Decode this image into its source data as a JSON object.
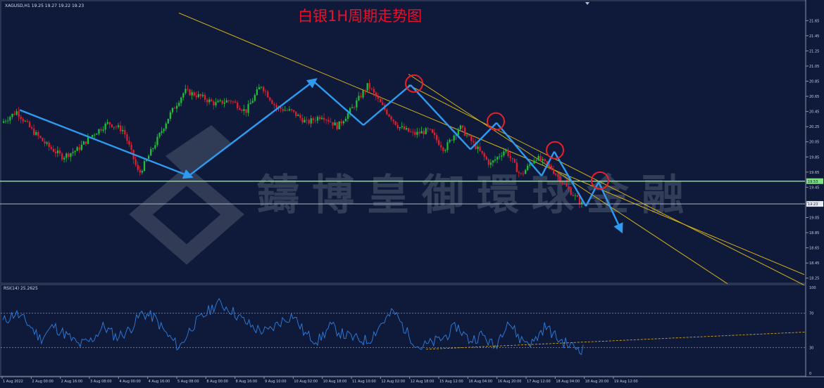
{
  "header": {
    "symbol_info": "XAGUSD,H1  19.25 19.27 19.22 19.23",
    "title": "白银1H周期走势图"
  },
  "watermark": {
    "text": "鑄博皇御環球金融"
  },
  "colors": {
    "background": "#0f1a3a",
    "up_candle": "#1fbf3a",
    "down_candle": "#e01e2e",
    "trend_arrow": "#2e9bf0",
    "channel_line": "#d4b21a",
    "circle": "#e8202a",
    "support_line": "#7ee07e",
    "current_line": "#c0c6d4",
    "rsi_line": "#2e7fe0",
    "rsi_trend": "#d4a21a",
    "title": "#e8102a"
  },
  "chart_data": [
    {
      "type": "candlestick",
      "title": "白银1H周期走势图",
      "price_ticks": [
        "21.65",
        "21.45",
        "21.25",
        "21.05",
        "20.85",
        "20.65",
        "20.45",
        "20.25",
        "20.05",
        "19.85",
        "19.65",
        "19.45",
        "19.25",
        "19.05",
        "18.85",
        "18.65",
        "18.45",
        "18.25"
      ],
      "ylim": [
        18.25,
        21.75
      ],
      "time_ticks": [
        "1 Aug 2022",
        "2 Aug 00:00",
        "2 Aug 16:00",
        "3 Aug 08:00",
        "4 Aug 00:00",
        "4 Aug 16:00",
        "5 Aug 08:00",
        "8 Aug 00:00",
        "8 Aug 16:00",
        "9 Aug 10:00",
        "10 Aug 02:00",
        "10 Aug 18:00",
        "11 Aug 10:00",
        "12 Aug 02:00",
        "12 Aug 18:00",
        "15 Aug 12:00",
        "16 Aug 04:00",
        "16 Aug 20:00",
        "17 Aug 12:00",
        "18 Aug 04:00",
        "18 Aug 20:00",
        "19 Aug 12:00"
      ],
      "key_levels": [
        {
          "name": "support",
          "value": 19.53,
          "label": "19.53"
        },
        {
          "name": "current",
          "value": 19.23,
          "label": "19.23"
        }
      ],
      "trend_path_prices": [
        20.47,
        19.6,
        20.85,
        20.27,
        20.8,
        19.95,
        20.3,
        19.6,
        19.92,
        19.2,
        19.52,
        18.9
      ],
      "pivot_circles": [
        20.8,
        20.3,
        19.92,
        19.52
      ],
      "channel": {
        "upper_start": 21.75,
        "upper_end": 18.25,
        "lower_start": 20.85,
        "lower_end": 18.25
      },
      "price_anchors": [
        20.3,
        20.45,
        20.2,
        20.0,
        19.85,
        19.95,
        20.15,
        20.3,
        20.2,
        19.62,
        20.0,
        20.4,
        20.72,
        20.65,
        20.55,
        20.6,
        20.45,
        20.8,
        20.5,
        20.45,
        20.3,
        20.4,
        20.25,
        20.5,
        20.8,
        20.5,
        20.25,
        20.15,
        20.2,
        19.95,
        20.25,
        20.0,
        19.75,
        19.95,
        19.6,
        19.85,
        19.7,
        19.45,
        19.23
      ]
    },
    {
      "type": "line",
      "title": "RSI(14) 25.2625",
      "series_name": "RSI(14)",
      "ylim": [
        0,
        100
      ],
      "rsi_ticks": [
        "100",
        "70",
        "30",
        "0"
      ],
      "levels": [
        70,
        30
      ],
      "anchors": [
        60,
        70,
        58,
        40,
        55,
        45,
        33,
        38,
        55,
        42,
        50,
        70,
        65,
        45,
        30,
        55,
        68,
        82,
        75,
        62,
        52,
        48,
        60,
        68,
        45,
        38,
        55,
        45,
        40,
        38,
        58,
        72,
        48,
        30,
        35,
        42,
        55,
        38,
        45,
        30,
        62,
        40,
        35,
        55,
        40,
        32,
        28
      ],
      "trendline": [
        28,
        48
      ]
    }
  ]
}
